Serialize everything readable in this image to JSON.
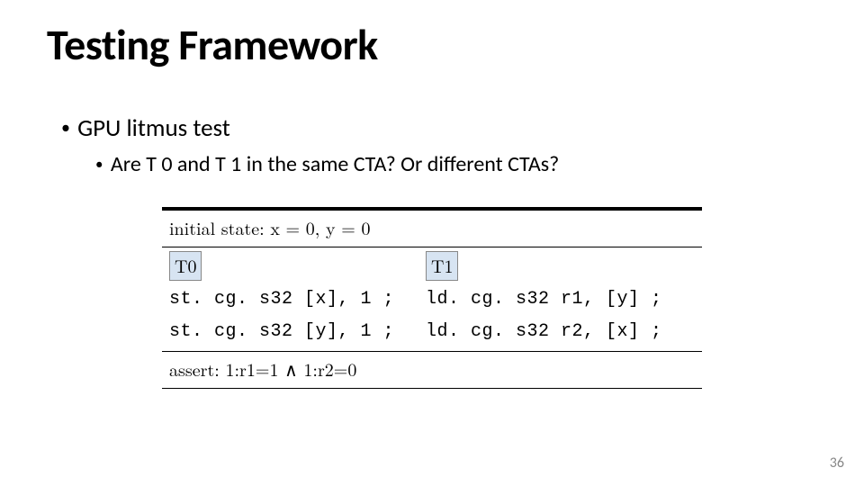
{
  "title": "Testing Framework",
  "bullets": {
    "l1": "GPU litmus test",
    "l2": "Are T 0 and T 1 in the same CTA? Or different CTAs?"
  },
  "table": {
    "initial_state": "initial state: x = 0, y = 0",
    "threads": {
      "t0": "T0",
      "t1": "T1"
    },
    "code": {
      "t0_l1": "st. cg. s32  [x],  1  ;",
      "t0_l2": "st. cg. s32  [y],  1  ;",
      "t1_l1": "ld. cg. s32  r1,  [y]  ;",
      "t1_l2": "ld. cg. s32  r2,  [x]  ;"
    },
    "assert": "assert: 1:r1=1 ∧ 1:r2=0"
  },
  "page_number": "36"
}
